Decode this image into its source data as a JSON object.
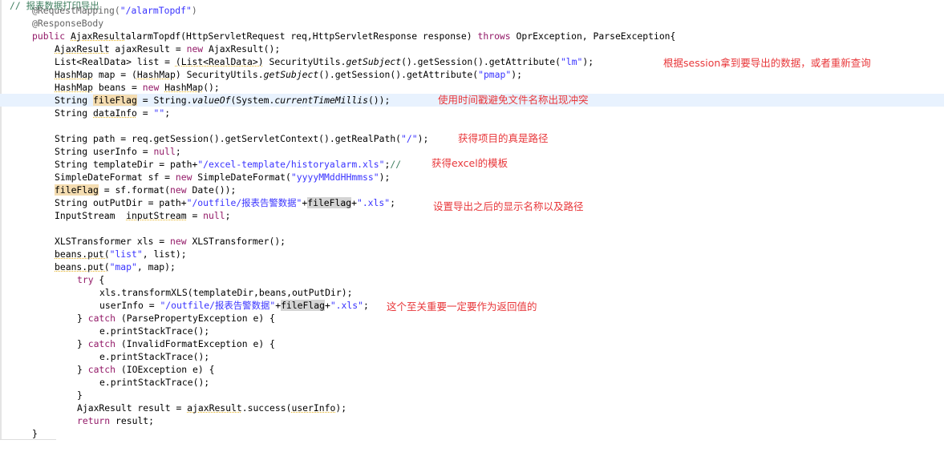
{
  "code_lines": [
    {
      "row": -0.4,
      "indent": 0,
      "tokens": [
        [
          "c",
          "// 报表数据打印导出"
        ]
      ]
    },
    {
      "row": 0,
      "indent": 1,
      "tokens": [
        [
          "a",
          "@RequestMapping("
        ],
        [
          "s",
          "\"/alarmTopdf\""
        ],
        [
          "a",
          ")"
        ]
      ]
    },
    {
      "row": 1,
      "indent": 1,
      "tokens": [
        [
          "a",
          "@ResponseBody"
        ]
      ]
    },
    {
      "row": 2,
      "indent": 1,
      "tokens": [
        [
          "k",
          "public "
        ],
        [
          "w",
          "AjaxResult"
        ],
        [
          "",
          "alarmTopdf(HttpServletRequest req,HttpServletResponse response) "
        ],
        [
          "k",
          "throws"
        ],
        [
          "",
          " OprException, ParseException{"
        ]
      ]
    },
    {
      "row": 3,
      "indent": 2,
      "tokens": [
        [
          "w",
          "AjaxResult"
        ],
        [
          "",
          " ajaxResult = "
        ],
        [
          "k",
          "new"
        ],
        [
          "",
          " AjaxResult();"
        ]
      ]
    },
    {
      "row": 4,
      "indent": 2,
      "tokens": [
        [
          "",
          "List<RealData> list = "
        ],
        [
          "w",
          "(List<RealData>)"
        ],
        [
          "",
          " SecurityUtils."
        ],
        [
          "it",
          "getSubject"
        ],
        [
          "",
          "().getSession().getAttribute("
        ],
        [
          "s",
          "\"lm\""
        ],
        [
          "",
          ");"
        ]
      ]
    },
    {
      "row": 5,
      "indent": 2,
      "tokens": [
        [
          "w",
          "HashMap"
        ],
        [
          "",
          " map = ("
        ],
        [
          "w",
          "HashMap"
        ],
        [
          ") SecurityUtils."
        ],
        [
          "it",
          "getSubject"
        ],
        [
          "",
          "().getSession().getAttribute("
        ],
        [
          "s",
          "\"pmap\""
        ],
        [
          "",
          ");"
        ]
      ]
    },
    {
      "row": 6,
      "indent": 2,
      "tokens": [
        [
          "w",
          "HashMap"
        ],
        [
          "",
          " beans = "
        ],
        [
          "k",
          "new"
        ],
        [
          " "
        ],
        [
          "w",
          "HashMap"
        ],
        [
          "",
          "();"
        ]
      ]
    },
    {
      "row": 7,
      "indent": 2,
      "cur": true,
      "tokens": [
        [
          "",
          "String "
        ],
        [
          "o",
          "fileFlag"
        ],
        [
          "",
          " = String."
        ],
        [
          "it",
          "valueOf"
        ],
        [
          "",
          "(System."
        ],
        [
          "it",
          "currentTimeMillis"
        ],
        [
          "",
          "());"
        ]
      ]
    },
    {
      "row": 8,
      "indent": 2,
      "tokens": [
        [
          "",
          "String "
        ],
        [
          "w",
          "dataInfo"
        ],
        [
          "",
          " = "
        ],
        [
          "s",
          "\"\""
        ],
        [
          "",
          ";"
        ]
      ]
    },
    {
      "row": 10,
      "indent": 2,
      "tokens": [
        [
          "",
          "String path = req.getSession().getServletContext().getRealPath("
        ],
        [
          "s",
          "\"/\""
        ],
        [
          "",
          ");"
        ]
      ]
    },
    {
      "row": 11,
      "indent": 2,
      "tokens": [
        [
          "",
          "String userInfo = "
        ],
        [
          "k",
          "null"
        ],
        [
          "",
          ";"
        ]
      ]
    },
    {
      "row": 12,
      "indent": 2,
      "tokens": [
        [
          "",
          "String templateDir = path+"
        ],
        [
          "s",
          "\"/excel-template/historyalarm.xls\""
        ],
        [
          "",
          ";"
        ],
        [
          "c",
          "//"
        ]
      ]
    },
    {
      "row": 13,
      "indent": 2,
      "tokens": [
        [
          "",
          "SimpleDateFormat sf = "
        ],
        [
          "k",
          "new"
        ],
        [
          "",
          " SimpleDateFormat("
        ],
        [
          "s",
          "\"yyyyMMddHHmmss\""
        ],
        [
          "",
          ");"
        ]
      ]
    },
    {
      "row": 14,
      "indent": 2,
      "tokens": [
        [
          "o",
          "fileFlag"
        ],
        [
          "",
          " = sf.format("
        ],
        [
          "k",
          "new"
        ],
        [
          "",
          " Date());"
        ]
      ]
    },
    {
      "row": 15,
      "indent": 2,
      "tokens": [
        [
          "",
          "String outPutDir = path+"
        ],
        [
          "s",
          "\"/outfile/报表告警数据\""
        ],
        [
          "",
          "+"
        ],
        [
          "g",
          "fileFlag"
        ],
        [
          "",
          "+"
        ],
        [
          "s",
          "\".xls\""
        ],
        [
          "",
          ";"
        ]
      ]
    },
    {
      "row": 16,
      "indent": 2,
      "tokens": [
        [
          "",
          "InputStream  "
        ],
        [
          "w",
          "inputStream"
        ],
        [
          "",
          " = "
        ],
        [
          "k",
          "null"
        ],
        [
          "",
          ";"
        ]
      ]
    },
    {
      "row": 18,
      "indent": 2,
      "tokens": [
        [
          "",
          "XLSTransformer xls = "
        ],
        [
          "k",
          "new"
        ],
        [
          "",
          " XLSTransformer();"
        ]
      ]
    },
    {
      "row": 19,
      "indent": 2,
      "tokens": [
        [
          "w",
          "beans.put("
        ],
        [
          "s",
          "\"list\""
        ],
        [
          "",
          ", list);"
        ]
      ]
    },
    {
      "row": 20,
      "indent": 2,
      "tokens": [
        [
          "w",
          "beans.put("
        ],
        [
          "s",
          "\"map\""
        ],
        [
          "",
          ", map);"
        ]
      ]
    },
    {
      "row": 21,
      "indent": 3,
      "tokens": [
        [
          "k",
          "try"
        ],
        [
          "",
          " {"
        ]
      ]
    },
    {
      "row": 22,
      "indent": 4,
      "tokens": [
        [
          "",
          "xls.transformXLS(templateDir,beans,outPutDir);"
        ]
      ]
    },
    {
      "row": 23,
      "indent": 4,
      "tokens": [
        [
          "",
          "userInfo = "
        ],
        [
          "s",
          "\"/outfile/报表告警数据\""
        ],
        [
          "",
          "+"
        ],
        [
          "g",
          "fileFlag"
        ],
        [
          "",
          "+"
        ],
        [
          "s",
          "\".xls\""
        ],
        [
          "",
          ";"
        ]
      ]
    },
    {
      "row": 24,
      "indent": 3,
      "tokens": [
        [
          "",
          "} "
        ],
        [
          "k",
          "catch"
        ],
        [
          "",
          " (ParsePropertyException e) {"
        ]
      ]
    },
    {
      "row": 25,
      "indent": 4,
      "tokens": [
        [
          "",
          "e.printStackTrace();"
        ]
      ]
    },
    {
      "row": 26,
      "indent": 3,
      "tokens": [
        [
          "",
          "} "
        ],
        [
          "k",
          "catch"
        ],
        [
          "",
          " (InvalidFormatException e) {"
        ]
      ]
    },
    {
      "row": 27,
      "indent": 4,
      "tokens": [
        [
          "",
          "e.printStackTrace();"
        ]
      ]
    },
    {
      "row": 28,
      "indent": 3,
      "tokens": [
        [
          "",
          "} "
        ],
        [
          "k",
          "catch"
        ],
        [
          "",
          " (IOException e) {"
        ]
      ]
    },
    {
      "row": 29,
      "indent": 4,
      "tokens": [
        [
          "",
          "e.printStackTrace();"
        ]
      ]
    },
    {
      "row": 30,
      "indent": 3,
      "tokens": [
        [
          "",
          "}"
        ]
      ]
    },
    {
      "row": 31,
      "indent": 3,
      "tokens": [
        [
          "",
          "AjaxResult result = "
        ],
        [
          "w",
          "ajaxResult"
        ],
        [
          "",
          ".success("
        ],
        [
          "w",
          "userInfo"
        ],
        [
          "",
          ");"
        ]
      ]
    },
    {
      "row": 32,
      "indent": 3,
      "tokens": [
        [
          "k",
          "return"
        ],
        [
          "",
          " result;"
        ]
      ]
    },
    {
      "row": 33,
      "indent": 1,
      "tokens": [
        [
          "",
          "}"
        ]
      ]
    }
  ],
  "annotations": {
    "session_data": "根据session拿到要导出的数据，或者重新查询",
    "timestamp": "使用时间戳避免文件名称出现冲突",
    "real_path": "获得项目的真是路径",
    "excel_template": "获得excel的模板",
    "output_name": "设置导出之后的显示名称以及路径",
    "return_value": "这个至关重要一定要作为返回值的"
  },
  "colors": {
    "keyword": "#931a68",
    "string": "#3933ff",
    "annotation_text": "#e8373a",
    "current_line": "#e8f2fe"
  }
}
